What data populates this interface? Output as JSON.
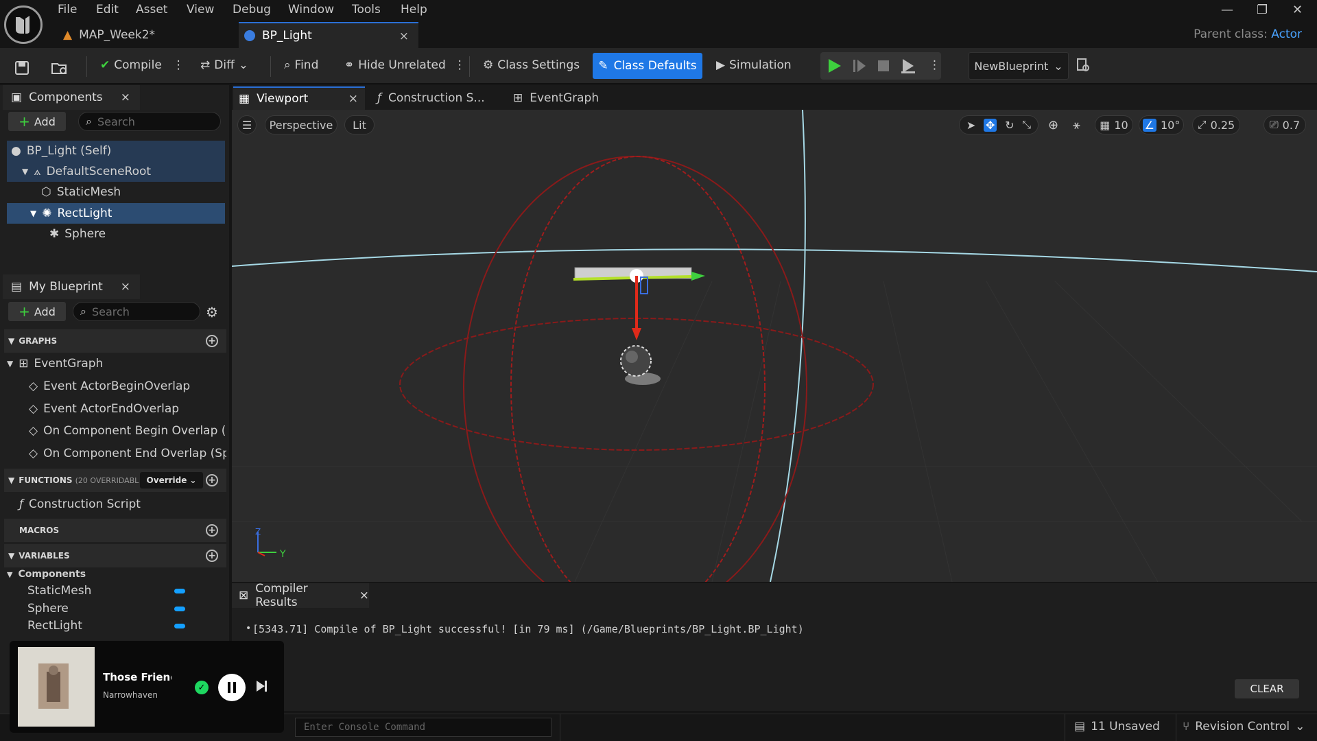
{
  "menu": [
    "File",
    "Edit",
    "Asset",
    "View",
    "Debug",
    "Window",
    "Tools",
    "Help"
  ],
  "tabs": [
    {
      "label": "MAP_Week2*"
    },
    {
      "label": "BP_Light",
      "close": "×"
    }
  ],
  "parent_class": {
    "label": "Parent class:",
    "value": "Actor"
  },
  "toolbar": {
    "compile": "Compile",
    "diff": "Diff",
    "find": "Find",
    "hide_unrelated": "Hide Unrelated",
    "class_settings": "Class Settings",
    "class_defaults": "Class Defaults",
    "simulation": "Simulation",
    "debug_object": "NewBlueprint"
  },
  "components_panel": {
    "title": "Components",
    "close": "×",
    "add": "Add",
    "search_placeholder": "Search",
    "tree": [
      {
        "label": "BP_Light (Self)"
      },
      {
        "label": "DefaultSceneRoot"
      },
      {
        "label": "StaticMesh"
      },
      {
        "label": "RectLight",
        "selected": true
      },
      {
        "label": "Sphere"
      }
    ]
  },
  "my_blueprint": {
    "title": "My Blueprint",
    "close": "×",
    "add": "Add",
    "search_placeholder": "Search",
    "graphs_header": "GRAPHS",
    "graphs": {
      "name": "EventGraph",
      "events": [
        "Event ActorBeginOverlap",
        "Event ActorEndOverlap",
        "On Component Begin Overlap (Sph",
        "On Component End Overlap (Sphe"
      ]
    },
    "functions_header": "FUNCTIONS",
    "functions_count": "(20 OVERRIDABL",
    "override_label": "Override",
    "functions": [
      "Construction Script"
    ],
    "macros_header": "MACROS",
    "variables_header": "VARIABLES",
    "variables_category": "Components",
    "variables": [
      "StaticMesh",
      "Sphere",
      "RectLight"
    ],
    "variables_accent": "#14a0ff"
  },
  "editor_tabs": [
    {
      "label": "Viewport",
      "close": "×"
    },
    {
      "label": "Construction S..."
    },
    {
      "label": "EventGraph"
    }
  ],
  "viewport": {
    "perspective": "Perspective",
    "lit": "Lit",
    "grid_snap": "10",
    "rotation_snap": "10°",
    "scale_snap": "0.25",
    "camera_speed": "0.7",
    "axis_z": "Z",
    "axis_y": "Y"
  },
  "compiler": {
    "title": "Compiler Results",
    "close": "×",
    "message": "[5343.71] Compile of BP_Light successful! [in 79 ms] (/Game/Blueprints/BP_Light.BP_Light)",
    "clear": "CLEAR"
  },
  "statusbar": {
    "console_placeholder": "Enter Console Command",
    "unsaved": "11 Unsaved",
    "revision_control": "Revision Control"
  },
  "media": {
    "track": "Those Friends",
    "artist": "Narrowhaven"
  },
  "colors": {
    "accent": "#1f78e6",
    "selected_row": "#2c4c72",
    "play_green": "#3ecf3e",
    "spotify_green": "#1ed760"
  }
}
